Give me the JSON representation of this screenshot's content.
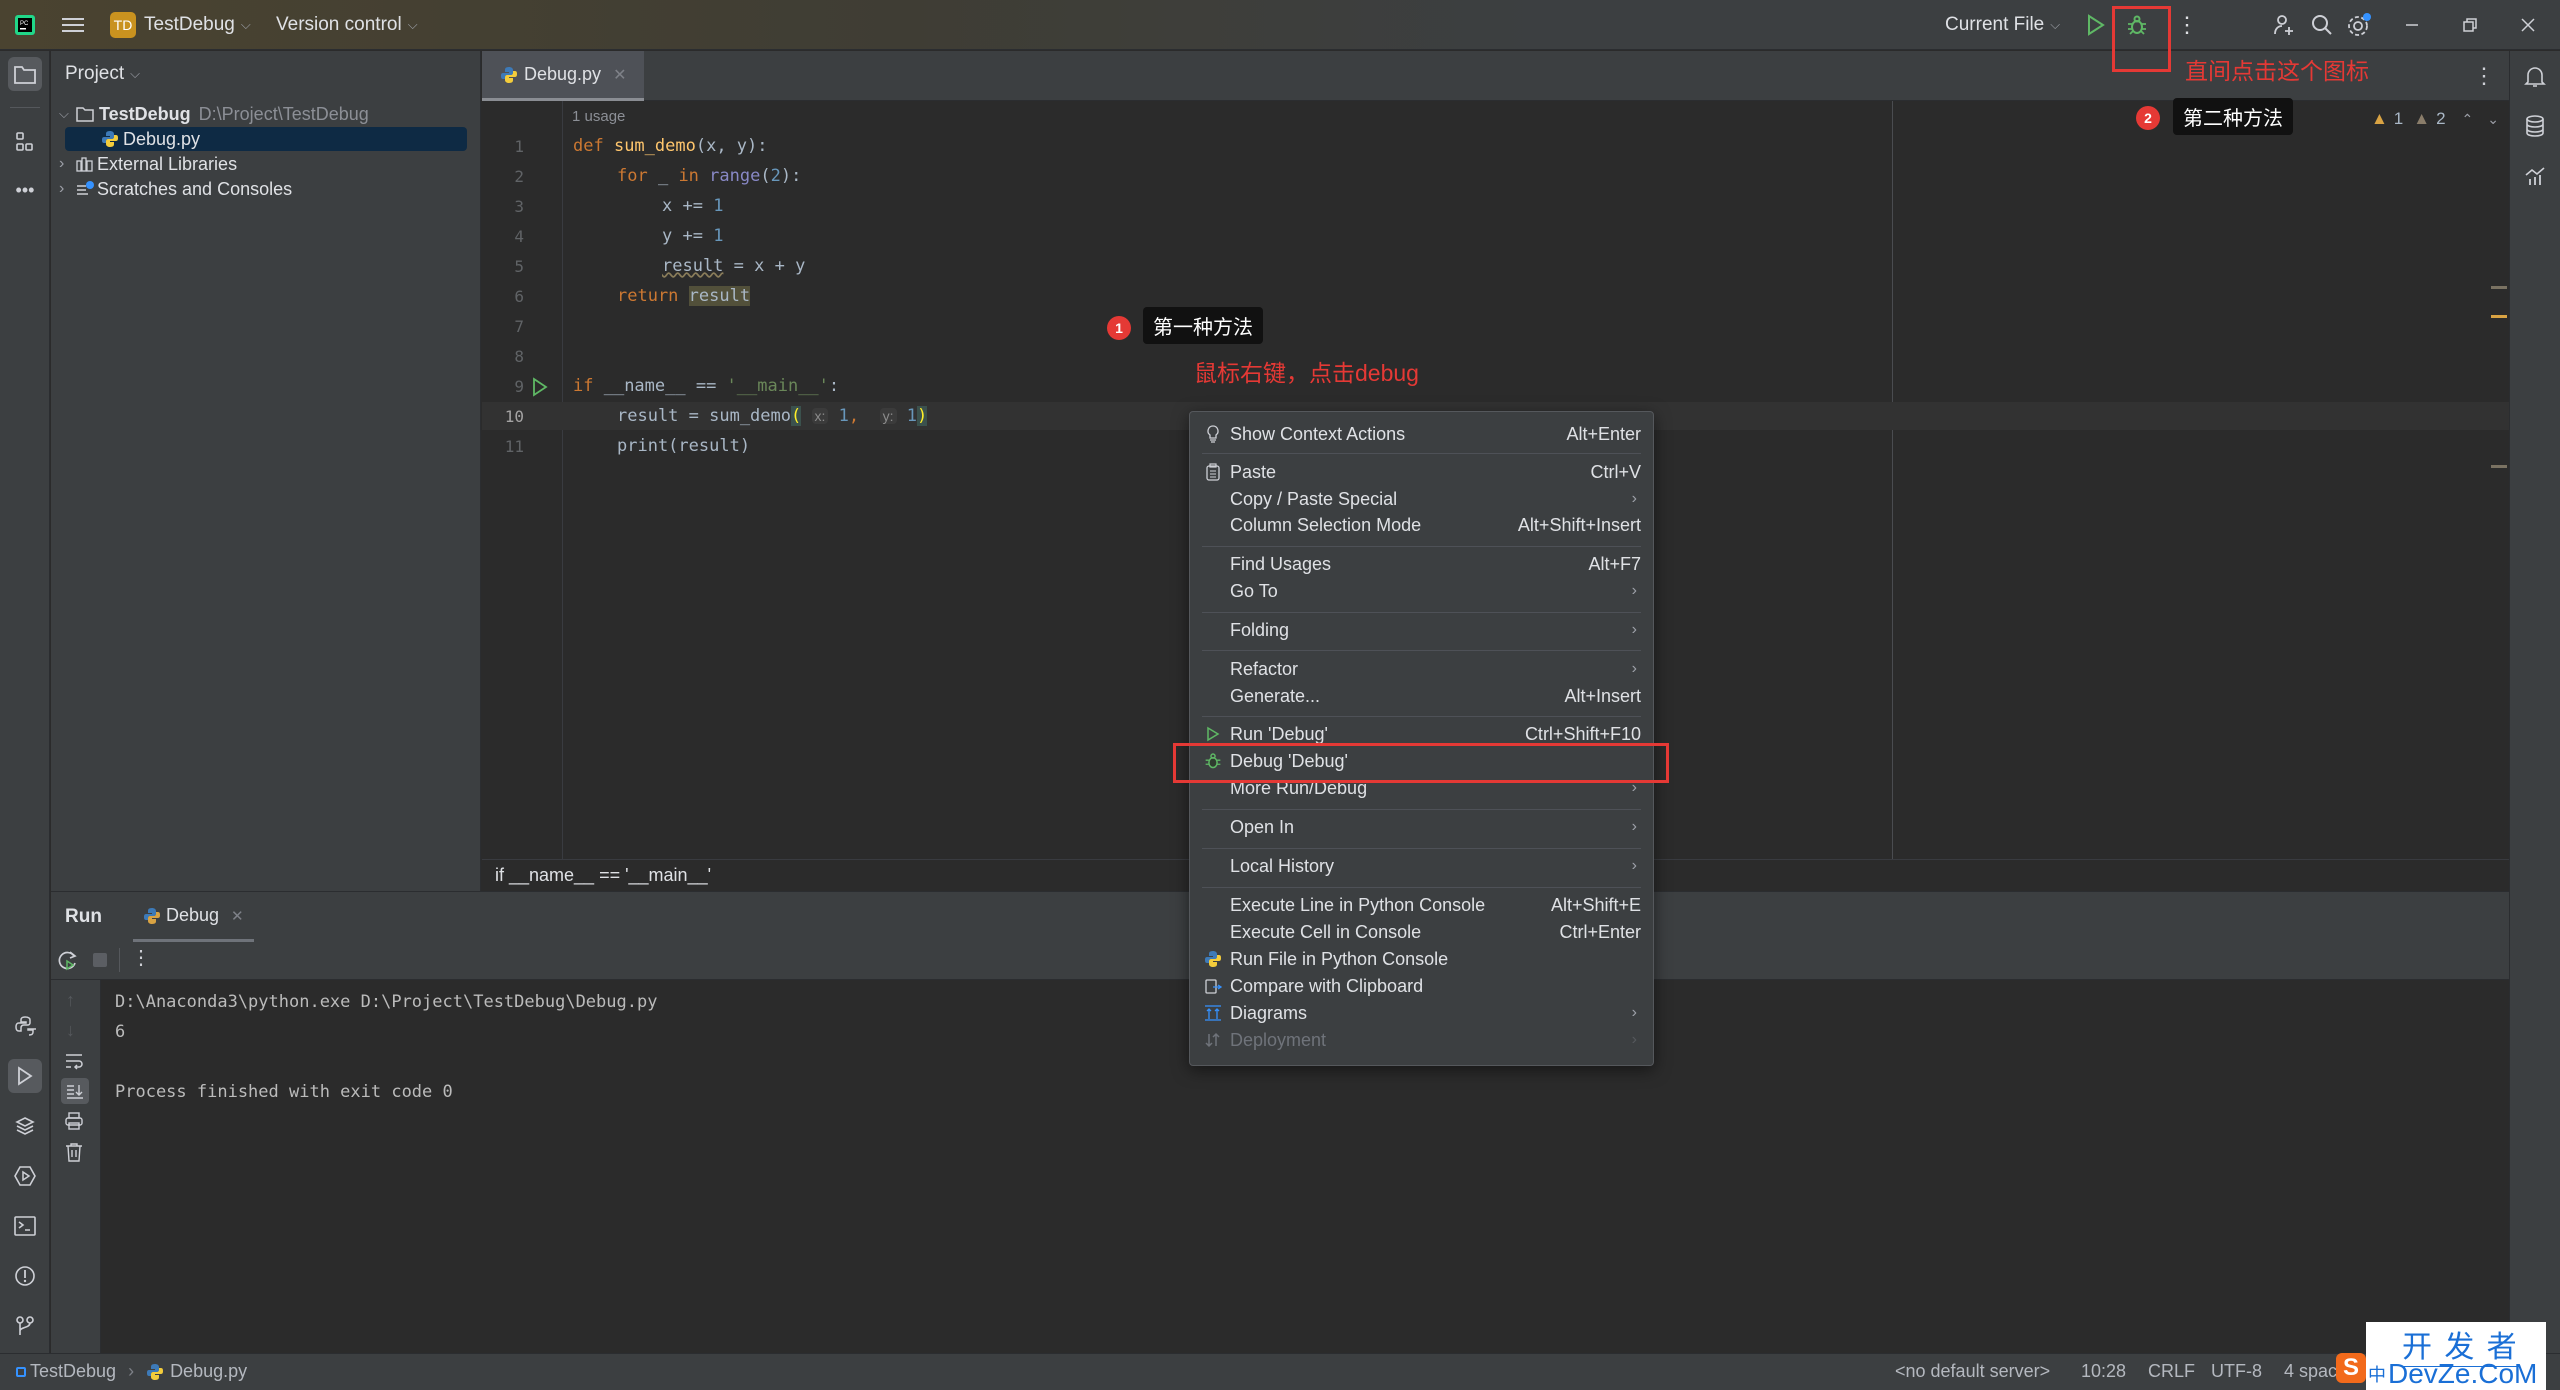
{
  "titlebar": {
    "project_badge": "TD",
    "project_name": "TestDebug",
    "vcs_label": "Version control",
    "run_config": "Current File"
  },
  "project_panel": {
    "title": "Project",
    "tree": [
      {
        "label": "TestDebug",
        "path": "D:\\Project\\TestDebug",
        "type": "folder",
        "expanded": true
      },
      {
        "label": "Debug.py",
        "type": "python-file",
        "selected": true
      },
      {
        "label": "External Libraries",
        "type": "library"
      },
      {
        "label": "Scratches and Consoles",
        "type": "scratches"
      }
    ]
  },
  "editor": {
    "tab_label": "Debug.py",
    "usage_hint": "1 usage",
    "line_numbers": [
      "1",
      "2",
      "3",
      "4",
      "5",
      "6",
      "7",
      "8",
      "9",
      "10",
      "11"
    ],
    "code": {
      "l1_kw": "def ",
      "l1_fn": "sum_demo",
      "l1_rest": "(x, y):",
      "l2_kw": "for",
      "l2_mid": " _ ",
      "l2_kw2": "in",
      "l2_bi": " range",
      "l2_p1": "(",
      "l2_num": "2",
      "l2_p2": "):",
      "l3_txt": "x += ",
      "l3_num": "1",
      "l4_txt": "y += ",
      "l4_num": "1",
      "l5_txt": "result",
      "l5_rest": " = x + y",
      "l6_kw": "return ",
      "l6_var": "result",
      "l9_kw": "if",
      "l9_mid": " __name__ == ",
      "l9_str": "'__main__'",
      "l9_end": ":",
      "l10_a": "result = sum_demo",
      "l10_p1": "(",
      "l10_hx": "x:",
      "l10_n1": "1",
      "l10_c": ",",
      "l10_hy": "y:",
      "l10_n2": "1",
      "l10_p2": ")",
      "l11": "print(result)"
    },
    "inspection": {
      "warnings": "1",
      "weak_warnings": "2"
    },
    "breadcrumb": "if __name__ == '__main__'"
  },
  "context_menu": {
    "items": [
      {
        "label": "Show Context Actions",
        "shortcut": "Alt+Enter",
        "icon": "lightbulb-icon"
      },
      {
        "label": "Paste",
        "shortcut": "Ctrl+V",
        "icon": "clipboard-icon"
      },
      {
        "label": "Copy / Paste Special",
        "submenu": true
      },
      {
        "label": "Column Selection Mode",
        "shortcut": "Alt+Shift+Insert"
      },
      {
        "label": "Find Usages",
        "shortcut": "Alt+F7"
      },
      {
        "label": "Go To",
        "submenu": true
      },
      {
        "label": "Folding",
        "submenu": true
      },
      {
        "label": "Refactor",
        "submenu": true
      },
      {
        "label": "Generate...",
        "shortcut": "Alt+Insert"
      },
      {
        "label": "Run 'Debug'",
        "shortcut": "Ctrl+Shift+F10",
        "icon": "run-icon"
      },
      {
        "label": "Debug 'Debug'",
        "icon": "bug-icon",
        "highlighted": true
      },
      {
        "label": "More Run/Debug",
        "submenu": true
      },
      {
        "label": "Open In",
        "submenu": true
      },
      {
        "label": "Local History",
        "submenu": true
      },
      {
        "label": "Execute Line in Python Console",
        "shortcut": "Alt+Shift+E"
      },
      {
        "label": "Execute Cell in Console",
        "shortcut": "Ctrl+Enter"
      },
      {
        "label": "Run File in Python Console",
        "icon": "python-icon"
      },
      {
        "label": "Compare with Clipboard",
        "icon": "compare-clipboard-icon"
      },
      {
        "label": "Diagrams",
        "submenu": true,
        "icon": "diagrams-icon"
      },
      {
        "label": "Deployment",
        "submenu": true,
        "icon": "deployment-icon",
        "disabled": true
      }
    ]
  },
  "run_panel": {
    "title": "Run",
    "tab_label": "Debug",
    "console_lines": [
      "D:\\Anaconda3\\python.exe D:\\Project\\TestDebug\\Debug.py",
      "6",
      "",
      "Process finished with exit code 0"
    ]
  },
  "statusbar": {
    "project": "TestDebug",
    "file": "Debug.py",
    "server": "<no default server>",
    "position": "10:28",
    "line_sep": "CRLF",
    "encoding": "UTF-8",
    "indent": "4 spac"
  },
  "annotations": {
    "method1_num": "1",
    "method1_label": "第一种方法",
    "method1_desc": "鼠标右键，点击debug",
    "method2_num": "2",
    "method2_label": "第二种方法",
    "method2_desc": "直间点击这个图标"
  },
  "watermark": {
    "line1": "开 发 者",
    "line2": "DevZe.CoM"
  },
  "colors": {
    "accent_red": "#e53935",
    "run_green": "#5fb865",
    "selection": "#0e2a44"
  }
}
